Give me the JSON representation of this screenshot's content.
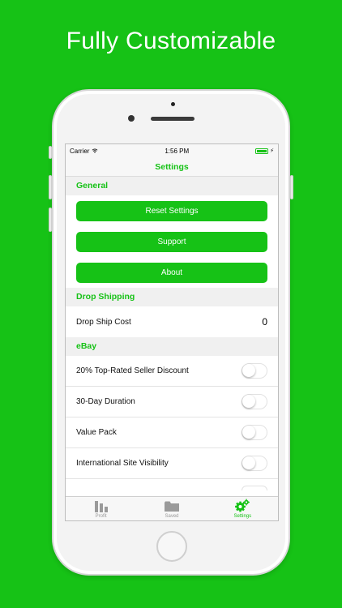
{
  "headline": "Fully Customizable",
  "status_bar": {
    "carrier": "Carrier",
    "time": "1:56 PM"
  },
  "nav": {
    "title": "Settings"
  },
  "sections": {
    "general": {
      "header": "General",
      "buttons": [
        "Reset Settings",
        "Support",
        "About"
      ]
    },
    "drop_shipping": {
      "header": "Drop Shipping",
      "rows": [
        {
          "label": "Drop Ship Cost",
          "value": "0"
        }
      ]
    },
    "ebay": {
      "header": "eBay",
      "rows": [
        {
          "label": "20% Top-Rated Seller Discount",
          "on": false
        },
        {
          "label": "30-Day Duration",
          "on": false
        },
        {
          "label": "Value Pack",
          "on": false
        },
        {
          "label": "International Site Visibility",
          "on": false
        }
      ]
    }
  },
  "tab_bar": {
    "tabs": [
      {
        "label": "Profit",
        "icon": "bar-chart-icon",
        "active": false
      },
      {
        "label": "Saved",
        "icon": "folder-icon",
        "active": false
      },
      {
        "label": "Settings",
        "icon": "gears-icon",
        "active": true
      }
    ]
  },
  "colors": {
    "accent": "#16c216",
    "background": "#16c216",
    "inactive_tab": "#9a9a9a"
  }
}
